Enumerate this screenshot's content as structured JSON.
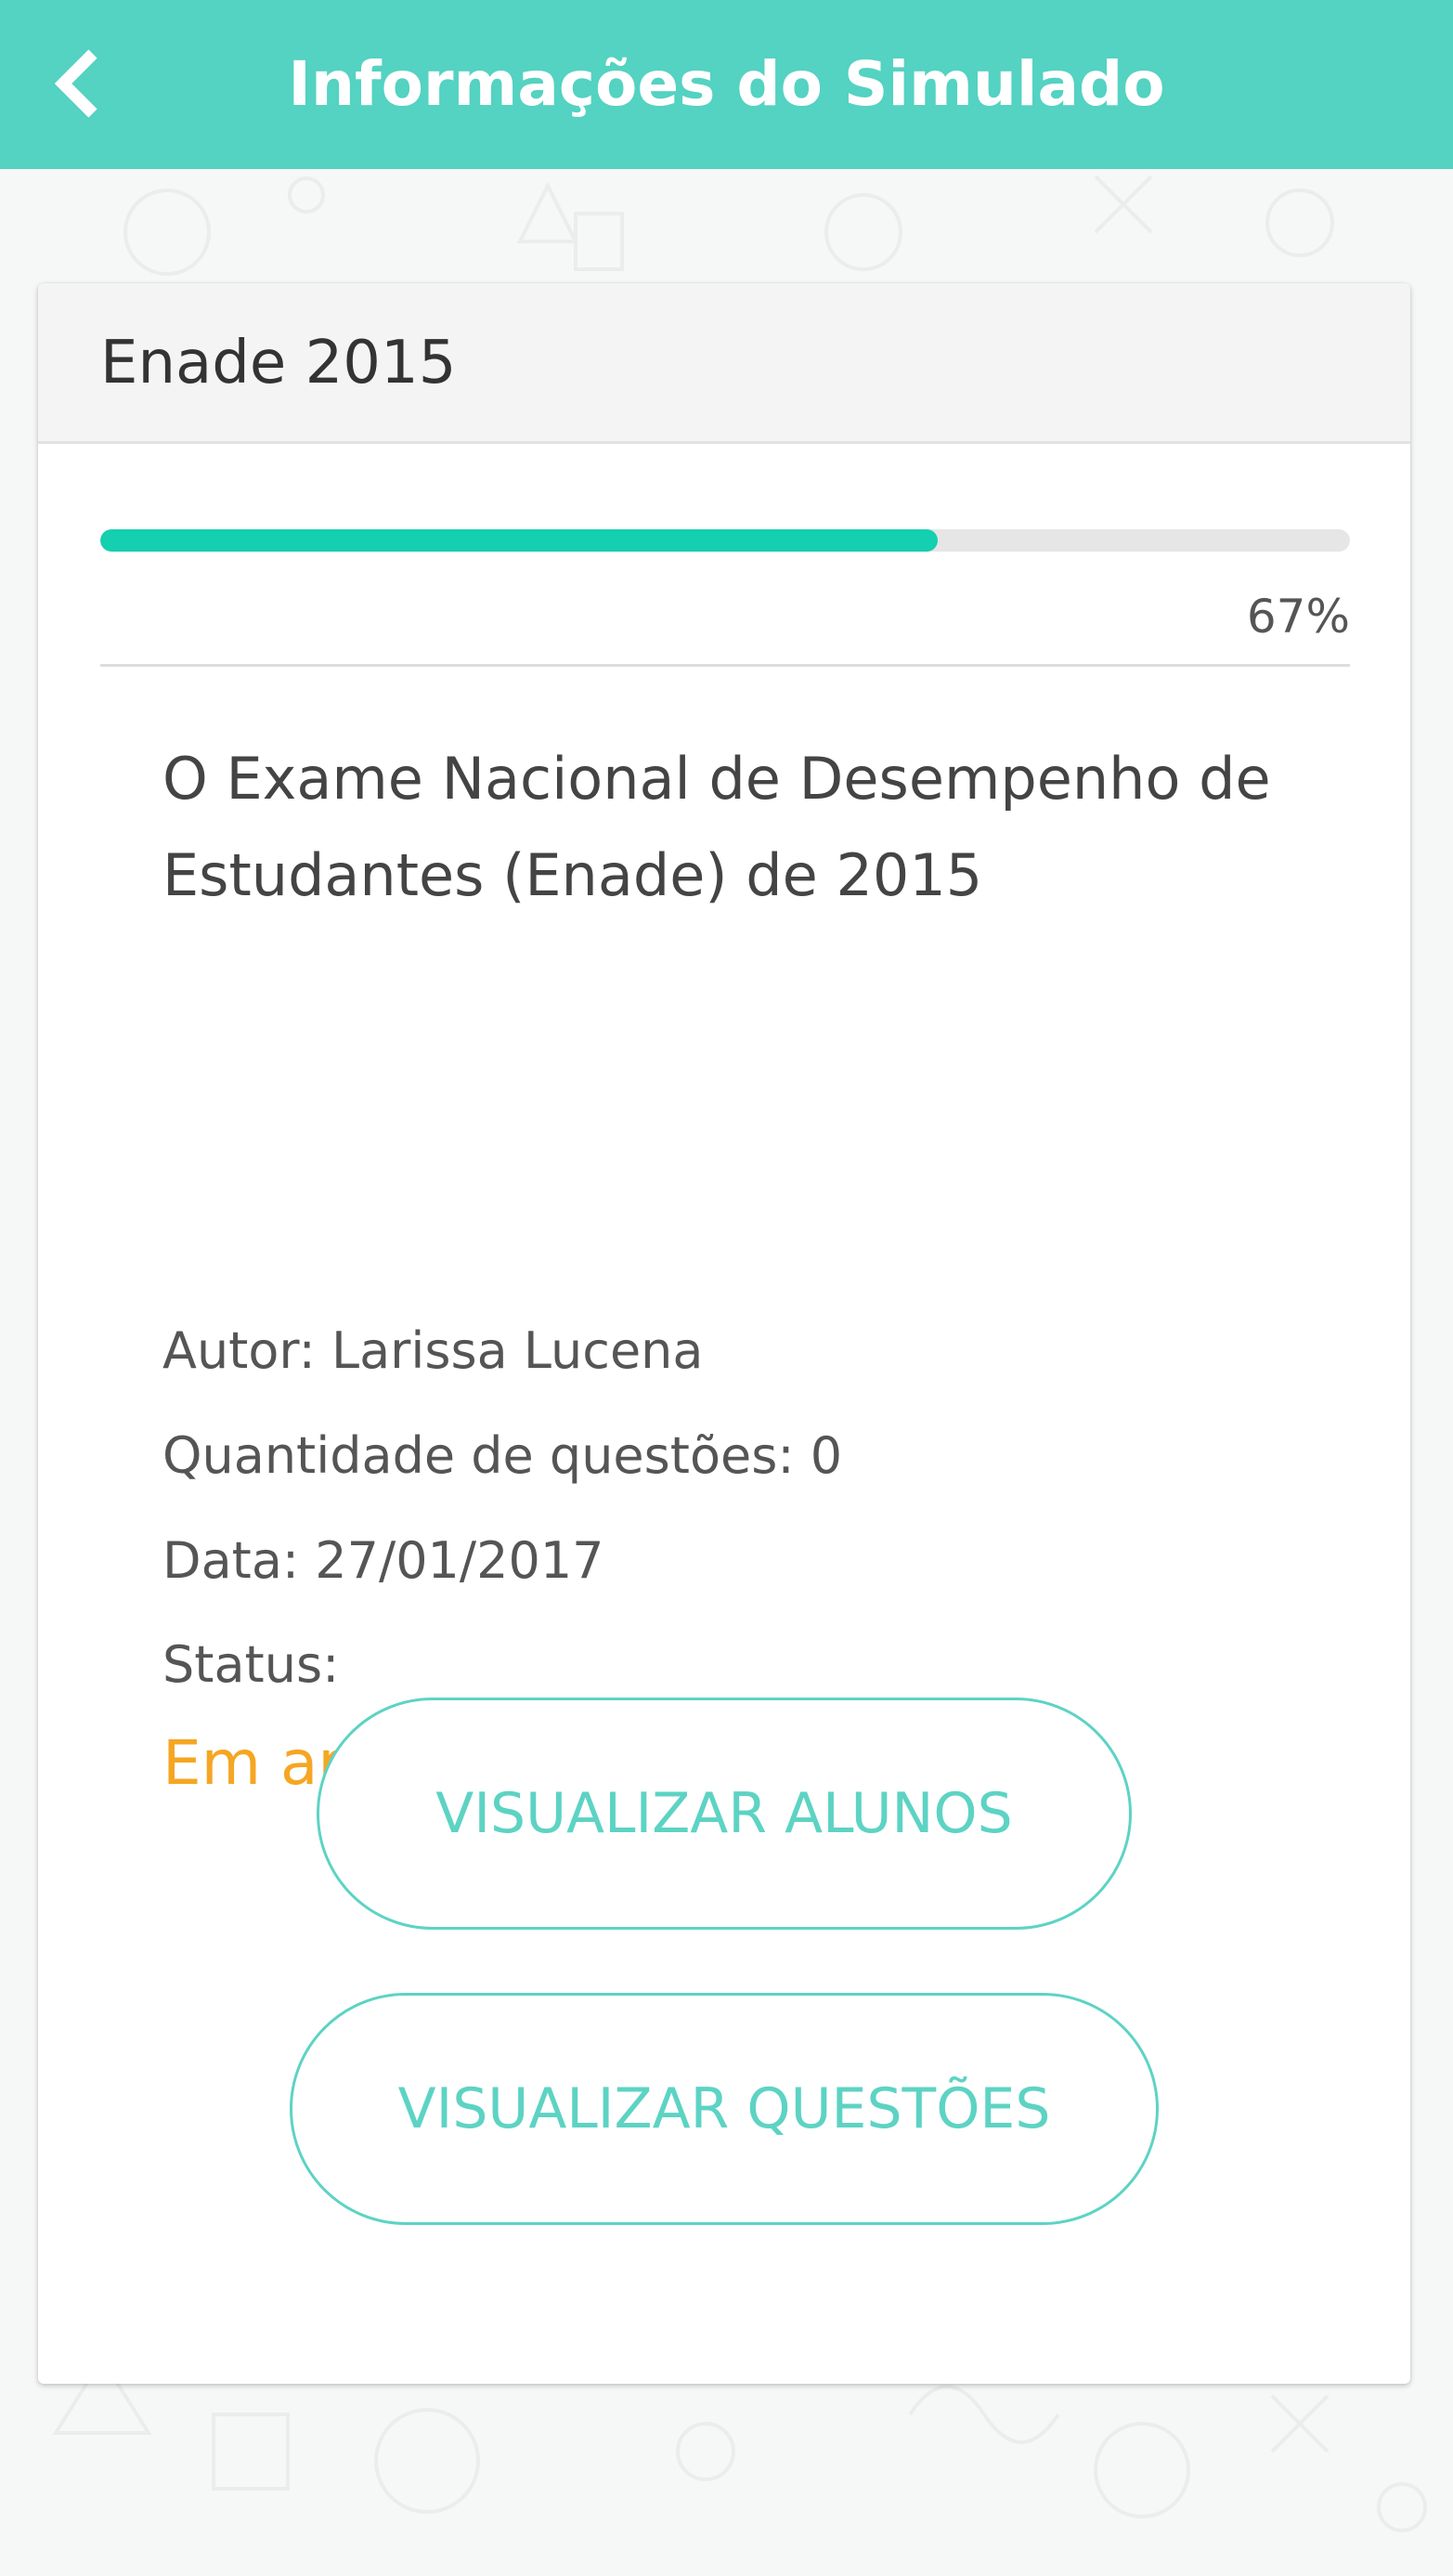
{
  "header": {
    "title": "Informações do Simulado",
    "back_icon": "chevron-left-icon"
  },
  "card": {
    "title": "Enade 2015",
    "progress": {
      "fraction": 0.67,
      "label": "67%"
    },
    "description": "O Exame Nacional de Desempenho de Estudantes (Enade) de 2015",
    "author": "Autor: Larissa Lucena",
    "question_count": "Quantidade de questões: 0",
    "date": "Data: 27/01/2017",
    "status_label": "Status:",
    "status_value": "Em andamento",
    "buttons": {
      "view_students": "VISUALIZAR ALUNOS",
      "view_questions": "VISUALIZAR QUESTÕES"
    }
  },
  "colors": {
    "header_bg": "#54d2c2",
    "progress_fill": "#14cfb0",
    "status": "#f5a623",
    "button_text": "#5dd3c4"
  }
}
